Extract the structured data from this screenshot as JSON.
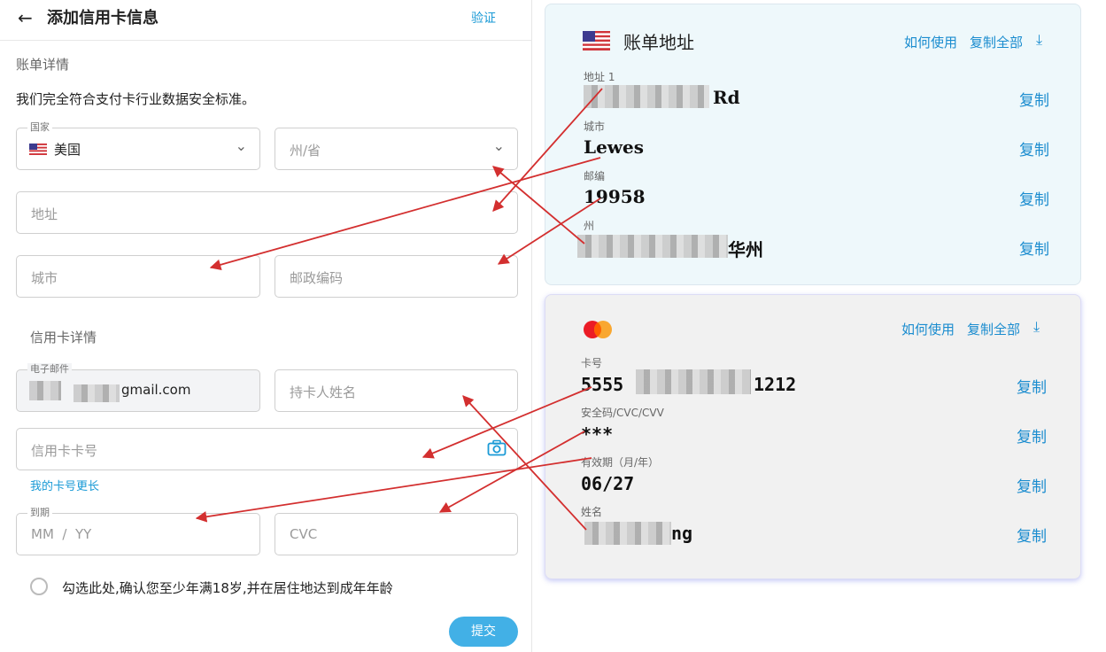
{
  "form": {
    "title": "添加信用卡信息",
    "verify": "验证",
    "billing_section": "账单详情",
    "compliance": "我们完全符合支付卡行业数据安全标准。",
    "country_legend": "国家",
    "country_value": "美国",
    "state_placeholder": "州/省",
    "address_placeholder": "地址",
    "city_placeholder": "城市",
    "zip_placeholder": "邮政编码",
    "card_section": "信用卡详情",
    "email_legend": "电子邮件",
    "email_value": "gmail.com",
    "holder_placeholder": "持卡人姓名",
    "card_number_placeholder": "信用卡卡号",
    "longer_card_link": "我的卡号更长",
    "expiry_legend": "到期",
    "expiry_placeholder": "MM  /  YY",
    "cvc_placeholder": "CVC",
    "age_checkbox_label": "勾选此处,确认您至少年满18岁,并在居住地达到成年年龄",
    "submit": "提交"
  },
  "billing_card": {
    "title": "账单地址",
    "how_to_use": "如何使用",
    "copy_all": "复制全部",
    "fields": [
      {
        "label": "地址 1",
        "value": "Rd"
      },
      {
        "label": "城市",
        "value": "Lewes"
      },
      {
        "label": "邮编",
        "value": "19958"
      },
      {
        "label": "州",
        "value": "华州"
      }
    ],
    "copy": "复制"
  },
  "payment_card": {
    "how_to_use": "如何使用",
    "copy_all": "复制全部",
    "fields": [
      {
        "label": "卡号",
        "value_start": "5555",
        "value_end": "1212"
      },
      {
        "label": "安全码/CVC/CVV",
        "value": "***"
      },
      {
        "label": "有效期（月/年）",
        "value": "06/27"
      },
      {
        "label": "姓名",
        "value": "ng"
      }
    ],
    "copy": "复制"
  },
  "colors": {
    "accent": "#1a9ad6",
    "submit_bg": "#42b0e6",
    "arrow": "#d32f2f",
    "billing_card_bg": "#eef8fb",
    "payment_card_bg": "#f1f1f1"
  },
  "icons": [
    "back-arrow-icon",
    "chevron-down-icon",
    "camera-icon",
    "us-flag-icon",
    "mastercard-icon",
    "download-icon"
  ]
}
